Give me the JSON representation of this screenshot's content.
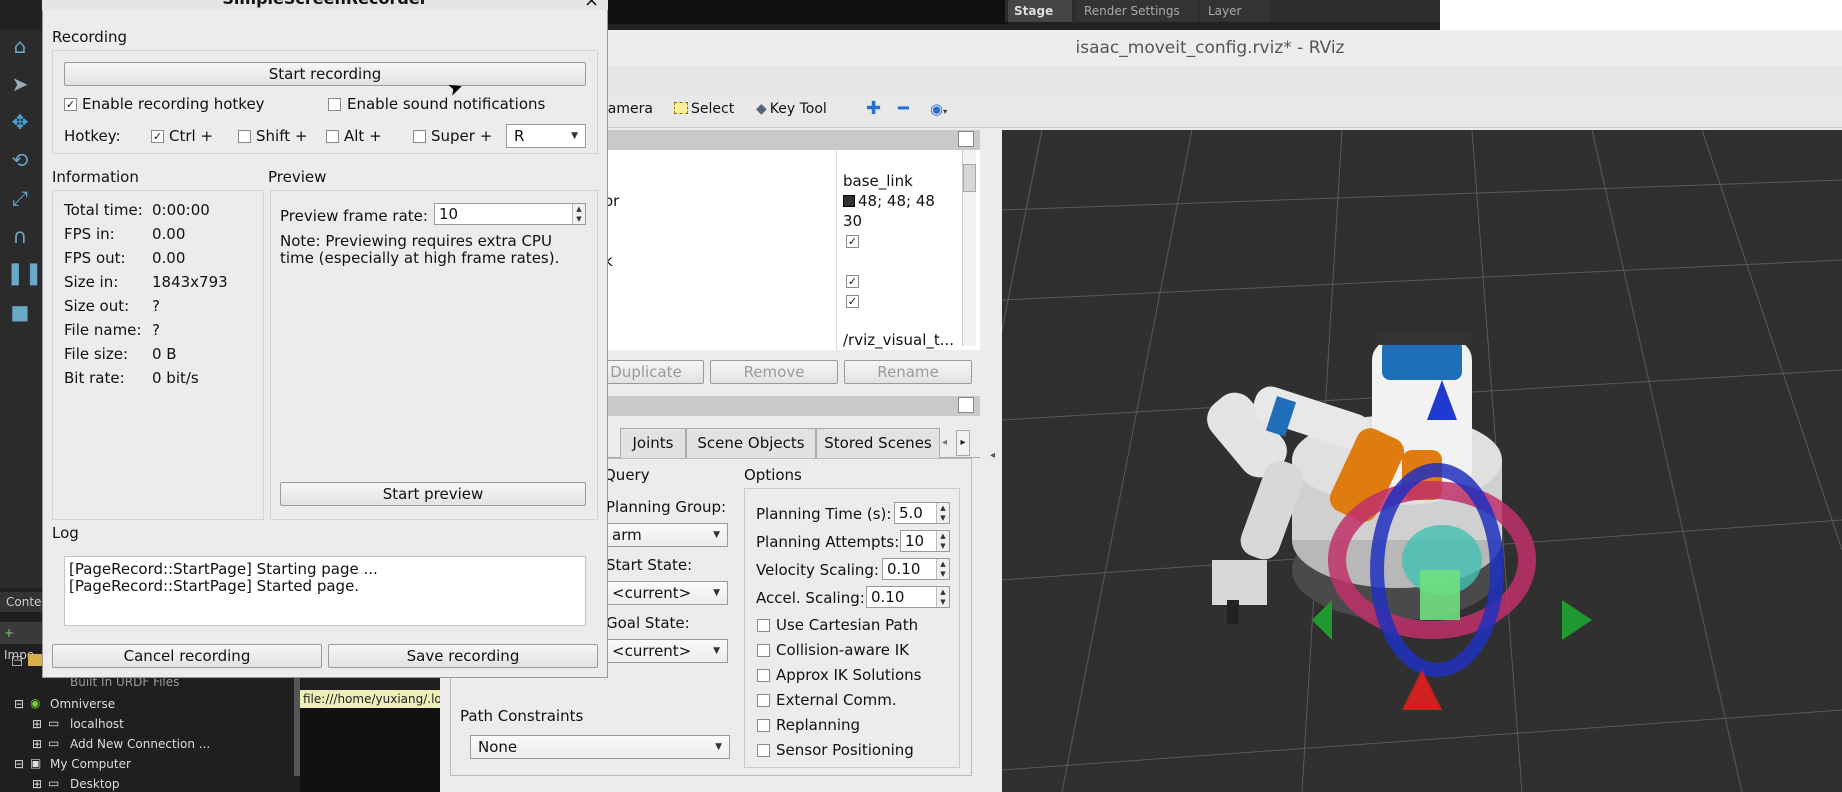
{
  "isaac": {
    "tabs": [
      "Stage",
      "Render Settings",
      "Layer"
    ],
    "content_tab": "Conte",
    "import_label": "Impo",
    "tree": {
      "urdf_item": "Built In URDF Files",
      "omniverse": "Omniverse",
      "localhost": "localhost",
      "add_connection": "Add New Connection ...",
      "my_computer": "My Computer",
      "desktop": "Desktop"
    },
    "path_tooltip": "file:///home/yuxiang/.loc"
  },
  "rviz": {
    "title": "isaac_moveit_config.rviz* - RViz",
    "toolbar": {
      "camera": "Camera",
      "select": "Select",
      "key_tool": "Key Tool"
    },
    "displays": {
      "values": [
        "base_link",
        "48; 48; 48",
        "30",
        "/rviz_visual_t..."
      ],
      "partial_labels": [
        "or",
        "k"
      ],
      "duplicate": "Duplicate",
      "remove": "Remove",
      "rename": "Rename"
    },
    "motion": {
      "tabs": [
        "Joints",
        "Scene Objects",
        "Stored Scenes"
      ],
      "query_label": "Query",
      "options_label": "Options",
      "planning_group_label": "Planning Group:",
      "planning_group": "arm",
      "start_state_label": "Start State:",
      "start_state": "<current>",
      "goal_state_label": "Goal State:",
      "goal_state": "<current>",
      "planning_time_label": "Planning Time (s):",
      "planning_time": "5.0",
      "planning_attempts_label": "Planning Attempts:",
      "planning_attempts": "10",
      "velocity_label": "Velocity Scaling:",
      "velocity": "0.10",
      "accel_label": "Accel. Scaling:",
      "accel": "0.10",
      "checkboxes": [
        "Use Cartesian Path",
        "Collision-aware IK",
        "Approx IK Solutions",
        "External Comm.",
        "Replanning",
        "Sensor Positioning"
      ],
      "path_constraints_label": "Path Constraints",
      "path_constraints": "None"
    }
  },
  "ssr": {
    "title": "SimpleScreenRecorder",
    "close": "×",
    "recording_label": "Recording",
    "start_recording": "Start recording",
    "enable_hotkey": "Enable recording hotkey",
    "enable_sound": "Enable sound notifications",
    "hotkey_label": "Hotkey:",
    "ctrl": "Ctrl +",
    "shift": "Shift +",
    "alt": "Alt +",
    "super": "Super +",
    "key": "R",
    "information_label": "Information",
    "info": [
      {
        "label": "Total time:",
        "value": "0:00:00"
      },
      {
        "label": "FPS in:",
        "value": "0.00"
      },
      {
        "label": "FPS out:",
        "value": "0.00"
      },
      {
        "label": "Size in:",
        "value": "1843x793"
      },
      {
        "label": "Size out:",
        "value": "?"
      },
      {
        "label": "File name:",
        "value": "?"
      },
      {
        "label": "File size:",
        "value": "0 B"
      },
      {
        "label": "Bit rate:",
        "value": "0 bit/s"
      }
    ],
    "preview_label": "Preview",
    "preview_rate_label": "Preview frame rate:",
    "preview_rate": "10",
    "preview_note": "Note: Previewing requires extra CPU time (especially at high frame rates).",
    "start_preview": "Start preview",
    "log_label": "Log",
    "log_lines": [
      "[PageRecord::StartPage] Starting page ...",
      "[PageRecord::StartPage] Started page."
    ],
    "cancel": "Cancel recording",
    "save": "Save recording"
  }
}
